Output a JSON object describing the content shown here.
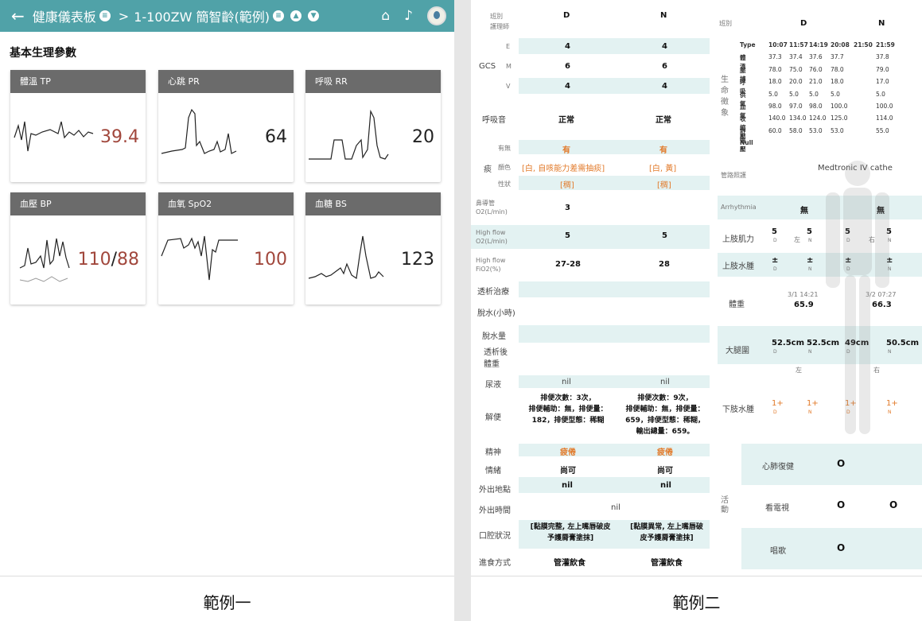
{
  "left": {
    "header": {
      "back_icon": "arrow-left-icon",
      "title": "健康儀表板",
      "separator": ">",
      "patient": "1-100ZW 簡智齡(範例)",
      "menu_icons": [
        "list-icon",
        "list-icon",
        "up-icon",
        "down-icon"
      ],
      "right_icons": [
        "home-icon",
        "bell-icon",
        "avatar"
      ]
    },
    "section_title": "基本生理參數",
    "cards": [
      {
        "label": "體溫 TP",
        "value": "39.4",
        "color": "#a1473c"
      },
      {
        "label": "心跳 PR",
        "value": "64",
        "color": "#222222"
      },
      {
        "label": "呼吸 RR",
        "value": "20",
        "color": "#222222"
      },
      {
        "label": "血壓 BP",
        "value_a": "110",
        "value_sep": "/",
        "value_b": "88",
        "color": "#a1473c"
      },
      {
        "label": "血氧 SpO2",
        "value": "100",
        "color": "#a1473c"
      },
      {
        "label": "血糖 BS",
        "value": "123",
        "color": "#222222"
      }
    ],
    "caption": "範例一"
  },
  "right": {
    "caption": "範例二",
    "left_col": {
      "shift_label": "班別\n護理師",
      "shift_d": "D",
      "shift_n": "N",
      "gcs": "GCS",
      "gcs_rows": [
        {
          "k": "E",
          "d": "4",
          "n": "4"
        },
        {
          "k": "M",
          "d": "6",
          "n": "6"
        },
        {
          "k": "V",
          "d": "4",
          "n": "4"
        }
      ],
      "breath": {
        "k": "呼吸音",
        "d": "正常",
        "n": "正常"
      },
      "sputum": "痰",
      "sputum_rows": [
        {
          "k": "有無",
          "d": "有",
          "n": "有"
        },
        {
          "k": "顏色",
          "d": "[白, 自咳能力差需抽痰]",
          "n": "[白, 黃]"
        },
        {
          "k": "性狀",
          "d": "[稠]",
          "n": "[稠]"
        }
      ],
      "o2_rows": [
        {
          "k": "鼻導管\nO2(L/min)",
          "d": "3",
          "n": ""
        },
        {
          "k": "High flow\nO2(L/min)",
          "d": "5",
          "n": "5"
        },
        {
          "k": "High flow\nFiO2(%)",
          "d": "27-28",
          "n": "28"
        }
      ],
      "dialysis": "透析治療",
      "dehydrate": "脫水(小時)",
      "dehydrate_amt": "脫水量",
      "post_weight": "透析後\n體重",
      "urine": {
        "k": "尿液",
        "d": "nil",
        "n": "nil"
      },
      "stool": {
        "k": "解便",
        "d": "排便次數：3次，\n排便輔助：無，排便量：\n182，排便型態：稀糊",
        "n": "排便次數：9次，\n排便輔助：無，排便量：\n659，排便型態：稀糊，\n輸出總量：659。"
      },
      "spirit": {
        "k": "精神",
        "d": "疲倦",
        "n": "疲倦"
      },
      "mood": {
        "k": "情緒",
        "d": "尚可",
        "n": "尚可"
      },
      "out_place": {
        "k": "外出地點",
        "d": "nil",
        "n": "nil"
      },
      "out_time": {
        "k": "外出時間",
        "v": "nil"
      },
      "oral": {
        "k": "口腔狀況",
        "d": "[黏膜完整, 左上嘴唇破皮\n予護脣膏塗抹]",
        "n": "[黏膜異常, 左上嘴唇破\n皮予護脣膏塗抹]"
      },
      "feeding": {
        "k": "進食方式",
        "d": "管灌飲食",
        "n": "管灌飲食"
      }
    },
    "right_col": {
      "shift_label": "班別",
      "shift_d": "D",
      "shift_n": "N",
      "vitals_label": "生\n命\n徵\n象",
      "vitals_header": [
        "Type",
        "10:07",
        "11:57",
        "14:19",
        "20:08",
        "21:50",
        "21:59"
      ],
      "vitals_rows": [
        [
          "體溫",
          "37.3",
          "37.4",
          "37.6",
          "37.7",
          "",
          "37.8"
        ],
        [
          "脈搏",
          "78.0",
          "75.0",
          "76.0",
          "78.0",
          "",
          "79.0"
        ],
        [
          "呼吸",
          "18.0",
          "20.0",
          "21.0",
          "18.0",
          "",
          "17.0"
        ],
        [
          "供氧",
          "5.0",
          "5.0",
          "5.0",
          "5.0",
          "",
          "5.0"
        ],
        [
          "血氧",
          "98.0",
          "97.0",
          "98.0",
          "100.0",
          "",
          "100.0"
        ],
        [
          "收縮壓",
          "140.0",
          "134.0",
          "124.0",
          "125.0",
          "",
          "114.0"
        ],
        [
          "舒張壓",
          "60.0",
          "58.0",
          "53.0",
          "53.0",
          "",
          "55.0"
        ],
        [
          "Null",
          "",
          "",
          "",
          "",
          "",
          ""
        ]
      ],
      "tube": {
        "k": "管路照護",
        "v": "Medtronic  IV cathe"
      },
      "arrhythmia": {
        "k": "Arrhythmia",
        "d": "無",
        "n": "無"
      },
      "upper_power": {
        "k": "上肢肌力",
        "vals": [
          "5",
          "5",
          "5",
          "5"
        ],
        "subs": [
          "D",
          "N",
          "D",
          "N"
        ],
        "left": "左",
        "right": "右"
      },
      "upper_edema": {
        "k": "上肢水腫",
        "vals": [
          "±",
          "±",
          "±",
          "±"
        ],
        "subs": [
          "D",
          "N",
          "D",
          "N"
        ]
      },
      "weight": {
        "k": "體重",
        "d_time": "3/1 14:21",
        "d_val": "65.9",
        "n_time": "3/2 07:27",
        "n_val": "66.3"
      },
      "thigh": {
        "k": "大腿圍",
        "vals": [
          "52.5",
          "52.5",
          "49",
          "50.5"
        ],
        "unit": "cm",
        "subs": [
          "D",
          "N",
          "D",
          "N"
        ],
        "left": "左",
        "right": "右"
      },
      "lower_edema": {
        "k": "下肢水腫",
        "vals": [
          "1+",
          "1+",
          "1+",
          "1+"
        ],
        "subs": [
          "D",
          "N",
          "D",
          "N"
        ]
      },
      "activity": "活\n動",
      "act_rows": [
        {
          "k": "心肺復健",
          "d": "O",
          "n": ""
        },
        {
          "k": "看電視",
          "d": "O",
          "n": "O"
        },
        {
          "k": "唱歌",
          "d": "O",
          "n": ""
        }
      ]
    }
  }
}
